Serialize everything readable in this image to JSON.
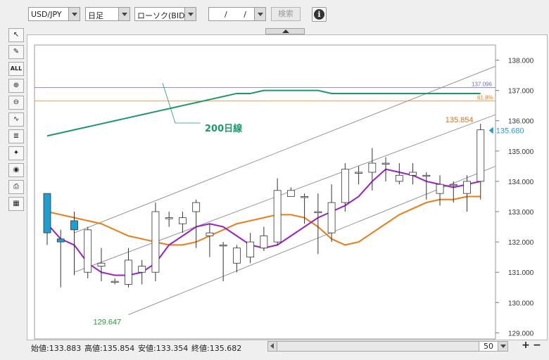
{
  "toolbar": {
    "pair": "USD/JPY",
    "period": "日足",
    "chart_type": "ローソク(BID)",
    "date": "/ /",
    "search_label": "検索",
    "info_label": "i"
  },
  "tools": [
    {
      "name": "cursor-tool",
      "glyph": "↖"
    },
    {
      "name": "pencil-tool",
      "glyph": "✎"
    },
    {
      "name": "erase-all-tool",
      "glyph": "ALL"
    },
    {
      "name": "zoom-in-tool",
      "glyph": "⊕"
    },
    {
      "name": "zoom-out-tool",
      "glyph": "⊖"
    },
    {
      "name": "indicator-tool",
      "glyph": "∿"
    },
    {
      "name": "price-table-tool",
      "glyph": "≣"
    },
    {
      "name": "symbols-tool",
      "glyph": "✦"
    },
    {
      "name": "view-tool",
      "glyph": "◉"
    },
    {
      "name": "print-tool",
      "glyph": "⎙"
    },
    {
      "name": "table-tool",
      "glyph": "▦"
    }
  ],
  "chart_data": {
    "type": "candlestick",
    "y_ticks": [
      "138.000",
      "137.000",
      "136.000",
      "135.000",
      "134.000",
      "133.000",
      "132.000",
      "131.000",
      "130.000",
      "129.000"
    ],
    "ylim": [
      128.8,
      138.5
    ],
    "candles": [
      [
        133.6,
        133.4,
        132.3,
        132.3,
        131.9
      ],
      [
        132.1,
        132.4,
        132.0,
        131.7,
        130.5
      ],
      [
        132.7,
        133.0,
        132.4,
        131.0,
        130.9
      ],
      [
        131.0,
        132.5,
        132.4,
        131.0,
        130.8
      ],
      [
        131.2,
        131.8,
        131.3,
        130.8,
        130.7
      ],
      [
        130.7,
        130.8,
        130.7,
        130.6,
        130.6
      ],
      [
        130.6,
        131.8,
        131.4,
        130.5,
        130.5
      ],
      [
        131.0,
        131.4,
        131.2,
        130.8,
        130.6
      ],
      [
        131.0,
        133.3,
        133.0,
        130.8,
        130.7
      ],
      [
        132.8,
        133.0,
        132.8,
        132.8,
        132.5
      ],
      [
        132.6,
        133.0,
        132.8,
        132.6,
        132.3
      ],
      [
        133.0,
        133.4,
        133.3,
        132.0,
        131.8
      ],
      [
        132.2,
        132.6,
        132.3,
        132.0,
        131.5
      ],
      [
        131.9,
        132.0,
        131.9,
        131.3,
        130.7
      ],
      [
        131.3,
        131.9,
        131.8,
        131.3,
        131.0
      ],
      [
        131.5,
        132.3,
        132.0,
        131.5,
        131.3
      ],
      [
        131.8,
        132.5,
        132.2,
        131.8,
        131.7
      ],
      [
        132.0,
        134.1,
        133.7,
        132.0,
        131.9
      ],
      [
        133.5,
        133.8,
        133.7,
        133.5,
        133.5
      ],
      [
        133.5,
        133.6,
        133.5,
        133.0,
        132.6
      ],
      [
        133.0,
        133.6,
        133.0,
        132.0,
        131.6
      ],
      [
        132.3,
        133.9,
        133.3,
        132.2,
        132.0
      ],
      [
        133.3,
        134.6,
        134.4,
        133.3,
        133.0
      ],
      [
        134.3,
        134.5,
        134.3,
        133.9,
        133.9
      ],
      [
        134.3,
        135.1,
        134.6,
        134.2,
        133.7
      ],
      [
        134.6,
        134.8,
        134.6,
        134.0,
        134.0
      ],
      [
        134.0,
        134.6,
        134.2,
        134.0,
        133.9
      ],
      [
        134.2,
        134.6,
        134.3,
        134.2,
        133.9
      ],
      [
        134.2,
        134.3,
        134.2,
        133.7,
        133.4
      ],
      [
        133.6,
        134.2,
        133.9,
        133.6,
        133.2
      ],
      [
        133.9,
        134.0,
        133.9,
        133.7,
        133.3
      ],
      [
        133.6,
        134.2,
        134.0,
        133.6,
        133.0
      ],
      [
        134.0,
        135.9,
        135.7,
        133.8,
        133.4
      ]
    ],
    "ma_short": [
      132.6,
      132.1,
      131.9,
      131.3,
      131.0,
      130.9,
      130.9,
      131.0,
      131.3,
      131.9,
      132.2,
      132.5,
      132.6,
      132.5,
      132.2,
      131.9,
      131.8,
      131.9,
      132.2,
      132.5,
      132.8,
      133.0,
      133.2,
      133.5,
      134.0,
      134.4,
      134.3,
      134.2,
      134.0,
      133.9,
      133.8,
      133.9,
      134.0
    ],
    "ma_mid": [
      133.0,
      132.9,
      132.8,
      132.7,
      132.6,
      132.4,
      132.2,
      132.1,
      132.0,
      131.9,
      131.9,
      132.0,
      132.2,
      132.4,
      132.6,
      132.7,
      132.8,
      132.9,
      132.9,
      132.8,
      132.5,
      132.1,
      131.9,
      132.0,
      132.3,
      132.6,
      132.9,
      133.1,
      133.3,
      133.4,
      133.4,
      133.5,
      133.5
    ],
    "ma_200": [
      135.5,
      135.6,
      135.7,
      135.8,
      135.9,
      136.0,
      136.1,
      136.2,
      136.3,
      136.4,
      136.5,
      136.6,
      136.7,
      136.8,
      136.9,
      136.9,
      137.0,
      137.0,
      137.0,
      137.0,
      137.0,
      136.9,
      136.9,
      136.9,
      136.9,
      136.9,
      136.9,
      136.9,
      136.9,
      136.9,
      136.9,
      136.9,
      136.9
    ],
    "ma_200_label": "200日線",
    "hline_blue_value": 137.096,
    "hline_blue_label": "137.096",
    "hline_orange_value": 136.65,
    "hline_orange_label": "61.8%",
    "high_label": "135.854",
    "low_label": "129.647",
    "current_label": "135.680",
    "colors": {
      "up": "#ffffff",
      "down": "#1f9fd0",
      "ma_short": "#9b1ec8",
      "ma_mid": "#f07a10",
      "ma_200": "#1a9a6a",
      "hline_blue": "#6a6ae0",
      "hline_orange": "#f07a10",
      "channel": "#8a8a8a",
      "high_label": "#e07020",
      "low_label": "#2a9a3a",
      "current_label": "#1f9fd0"
    }
  },
  "status": {
    "open": "始値:133.883",
    "high": "高値:135.854",
    "low": "安値:133.354",
    "close": "終値:135.682",
    "zoom": "50",
    "plus": "+",
    "minus": "−"
  }
}
